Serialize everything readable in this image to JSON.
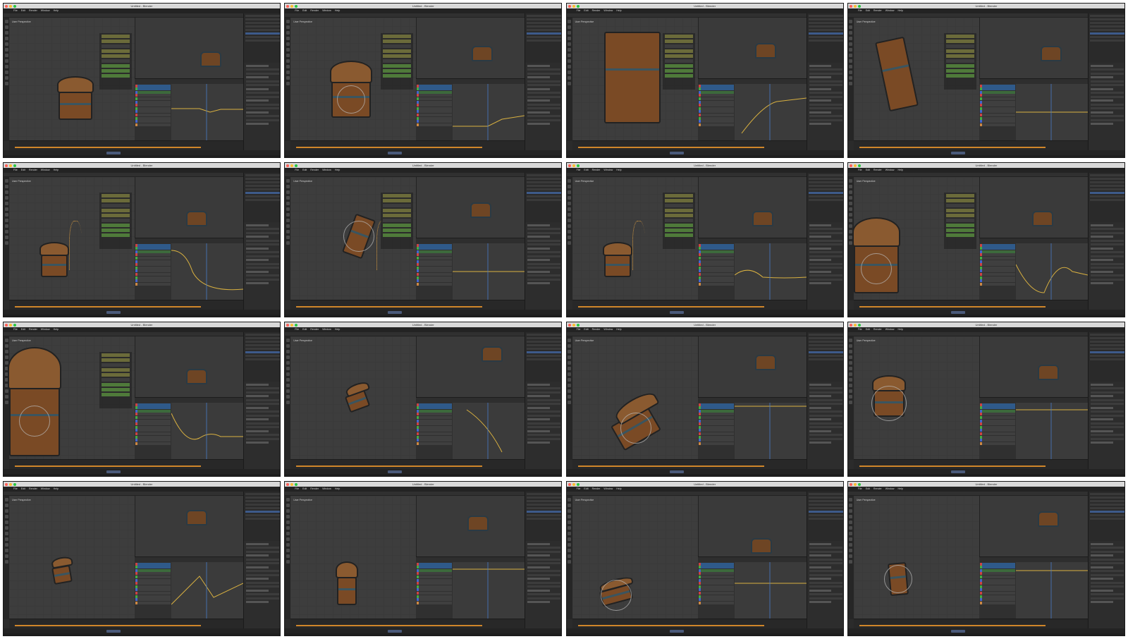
{
  "window_title": "Untitled - Blender",
  "menu": [
    "File",
    "Edit",
    "Render",
    "Window",
    "Help"
  ],
  "viewport_label": "User Perspective",
  "colors": {
    "accent_orange": "#d0862a",
    "selected_blue": "#2f5a8a",
    "keyframe_green": "#4f7a3a"
  },
  "tiles_count": 16
}
